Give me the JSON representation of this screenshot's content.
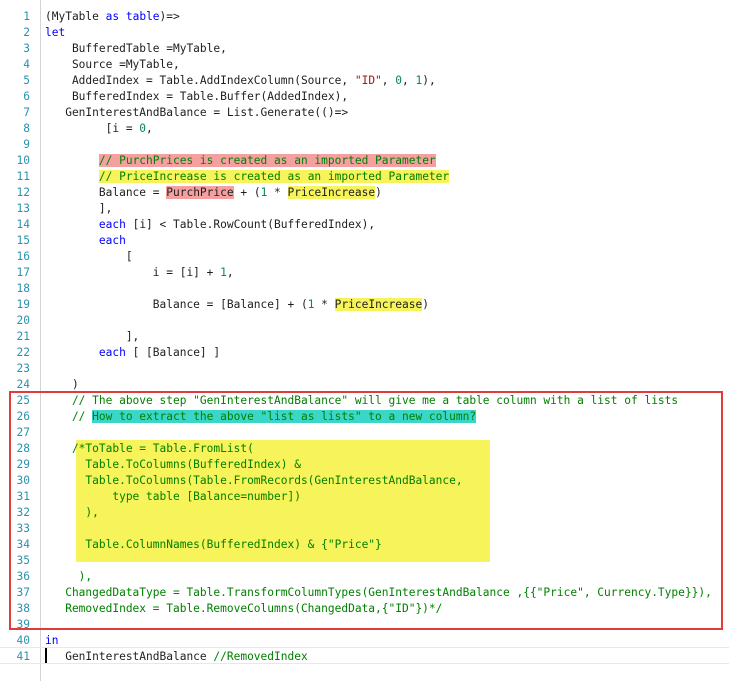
{
  "editor": {
    "lines": [
      {
        "n": "1",
        "t": "(MyTable as table)=>"
      },
      {
        "n": "2",
        "t": "let"
      },
      {
        "n": "3",
        "t": "    BufferedTable =MyTable,"
      },
      {
        "n": "4",
        "t": "    Source =MyTable,"
      },
      {
        "n": "5",
        "t": "    AddedIndex = Table.AddIndexColumn(Source, \"ID\", 0, 1),"
      },
      {
        "n": "6",
        "t": "    BufferedIndex = Table.Buffer(AddedIndex),"
      },
      {
        "n": "7",
        "t": "   GenInterestAndBalance = List.Generate(()=>"
      },
      {
        "n": "8",
        "t": "         [i = 0,"
      },
      {
        "n": "9",
        "t": ""
      },
      {
        "n": "10",
        "t": "        // PurchPrices is created as an imported Parameter"
      },
      {
        "n": "11",
        "t": "        // PriceIncrease is created as an imported Parameter"
      },
      {
        "n": "12",
        "t": "        Balance = PurchPrice + (1 * PriceIncrease)"
      },
      {
        "n": "13",
        "t": "        ],"
      },
      {
        "n": "14",
        "t": "        each [i] < Table.RowCount(BufferedIndex),"
      },
      {
        "n": "15",
        "t": "        each"
      },
      {
        "n": "16",
        "t": "            ["
      },
      {
        "n": "17",
        "t": "                i = [i] + 1,"
      },
      {
        "n": "18",
        "t": ""
      },
      {
        "n": "19",
        "t": "                Balance = [Balance] + (1 * PriceIncrease)"
      },
      {
        "n": "20",
        "t": ""
      },
      {
        "n": "21",
        "t": "            ],"
      },
      {
        "n": "22",
        "t": "        each [ [Balance] ]"
      },
      {
        "n": "23",
        "t": ""
      },
      {
        "n": "24",
        "t": "    )"
      },
      {
        "n": "25",
        "t": "    // The above step \"GenInterestAndBalance\" will give me a table column with a list of lists"
      },
      {
        "n": "26",
        "t": "    // How to extract the above \"list as lists\" to a new column?"
      },
      {
        "n": "27",
        "t": ""
      },
      {
        "n": "28",
        "t": "    /*ToTable = Table.FromList("
      },
      {
        "n": "29",
        "t": "      Table.ToColumns(BufferedIndex) &"
      },
      {
        "n": "30",
        "t": "      Table.ToColumns(Table.FromRecords(GenInterestAndBalance,"
      },
      {
        "n": "31",
        "t": "          type table [Balance=number])"
      },
      {
        "n": "32",
        "t": "      ),"
      },
      {
        "n": "33",
        "t": ""
      },
      {
        "n": "34",
        "t": "      Table.ColumnNames(BufferedIndex) & {\"Price\"}"
      },
      {
        "n": "35",
        "t": ""
      },
      {
        "n": "36",
        "t": "     ),"
      },
      {
        "n": "37",
        "t": "   ChangedDataType = Table.TransformColumnTypes(GenInterestAndBalance ,{{\"Price\", Currency.Type}}),"
      },
      {
        "n": "38",
        "t": "   RemovedIndex = Table.RemoveColumns(ChangedData,{\"ID\"})*/"
      },
      {
        "n": "39",
        "t": ""
      },
      {
        "n": "40",
        "t": "in"
      },
      {
        "n": "41",
        "t": "   GenInterestAndBalance //RemovedIndex"
      }
    ]
  },
  "colors": {
    "keyword": "#0000ff",
    "string": "#a31515",
    "number": "#098658",
    "comment": "#008000",
    "line_number": "#2b91af",
    "highlight_red": "#f4a0a0",
    "highlight_yellow": "#f7f35a",
    "highlight_cyan": "#3ad6c8",
    "annotation_box": "#e03c3c"
  }
}
